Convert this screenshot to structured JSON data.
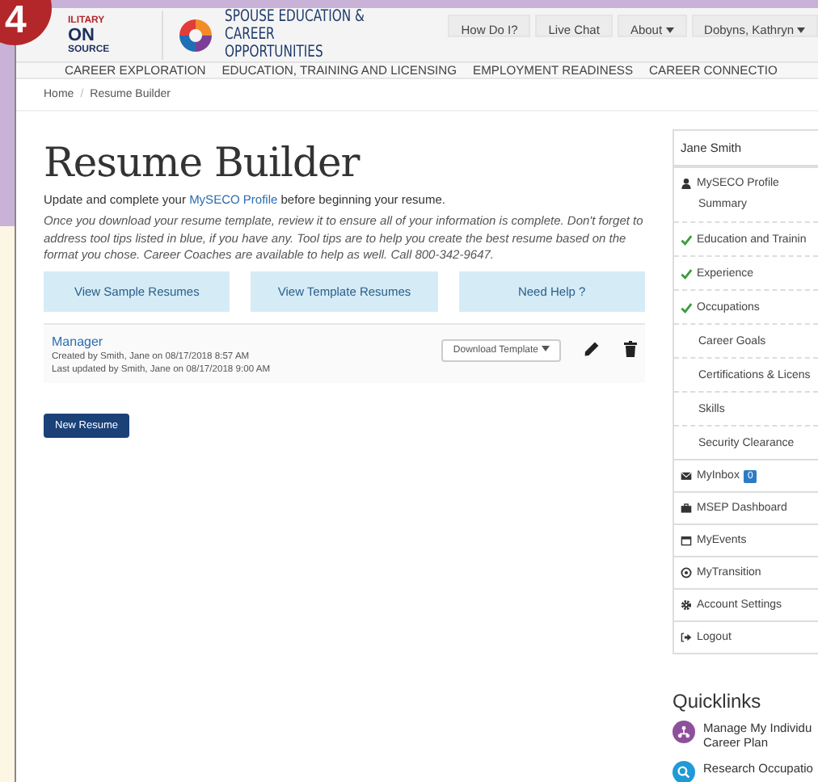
{
  "step_badge": "4",
  "header": {
    "logo_top": "ILITARY",
    "logo_mid": "ON",
    "logo_bottom": "SOURCE",
    "brand_line1": "SPOUSE EDUCATION &",
    "brand_line2": "CAREER OPPORTUNITIES",
    "links": [
      {
        "label": "How Do I?",
        "dropdown": false
      },
      {
        "label": "Live Chat",
        "dropdown": false
      },
      {
        "label": "About",
        "dropdown": true
      },
      {
        "label": "Dobyns, Kathryn",
        "dropdown": true
      }
    ]
  },
  "nav": [
    "CAREER EXPLORATION",
    "EDUCATION, TRAINING AND LICENSING",
    "EMPLOYMENT READINESS",
    "CAREER CONNECTIO"
  ],
  "breadcrumb": {
    "items": [
      "Home",
      "Resume Builder"
    ],
    "separator": "/"
  },
  "page": {
    "title": "Resume Builder",
    "intro_before": "Update and complete your ",
    "intro_link": "MySECO Profile",
    "intro_after": " before beginning your resume.",
    "note": "Once you download your resume template, review it to ensure all of your information is complete. Don't forget to address tool tips listed in blue, if you have any. Tool tips are to help you create the best resume based on the format you chose. Career Coaches are available to help as well. Call 800-342-9647.",
    "buttons": [
      "View Sample Resumes",
      "View Template Resumes",
      "Need Help ?"
    ],
    "resumes": [
      {
        "name": "Manager",
        "created": "Created by Smith, Jane on 08/17/2018 8:57 AM",
        "updated": "Last updated by Smith, Jane on 08/17/2018 9:00 AM",
        "download": "Download Template"
      }
    ],
    "new_button": "New Resume"
  },
  "sidebar": {
    "user": "Jane Smith",
    "items": [
      {
        "kind": "section",
        "label": "MySECO Profile"
      },
      {
        "kind": "sub",
        "label": "Summary",
        "completed": false
      },
      {
        "kind": "sub",
        "label": "Education and Trainin",
        "completed": true
      },
      {
        "kind": "sub",
        "label": "Experience",
        "completed": true
      },
      {
        "kind": "sub",
        "label": "Occupations",
        "completed": true
      },
      {
        "kind": "sub",
        "label": "Career Goals",
        "completed": false
      },
      {
        "kind": "sub",
        "label": "Certifications & Licens",
        "completed": false
      },
      {
        "kind": "sub",
        "label": "Skills",
        "completed": false
      },
      {
        "kind": "sub",
        "label": "Security Clearance",
        "completed": false
      },
      {
        "kind": "section",
        "label": "MyInbox",
        "badge": "0"
      },
      {
        "kind": "section",
        "label": "MSEP Dashboard"
      },
      {
        "kind": "section",
        "label": "MyEvents"
      },
      {
        "kind": "section",
        "label": "MyTransition"
      },
      {
        "kind": "section",
        "label": "Account Settings"
      },
      {
        "kind": "section",
        "label": "Logout"
      }
    ],
    "quicklinks_title": "Quicklinks",
    "quicklinks": [
      {
        "lines": [
          "Manage My Individu",
          "Career Plan"
        ],
        "color": "#8e4f9c"
      },
      {
        "lines": [
          "Research Occupatio"
        ],
        "color": "#1f9ad6"
      }
    ]
  }
}
